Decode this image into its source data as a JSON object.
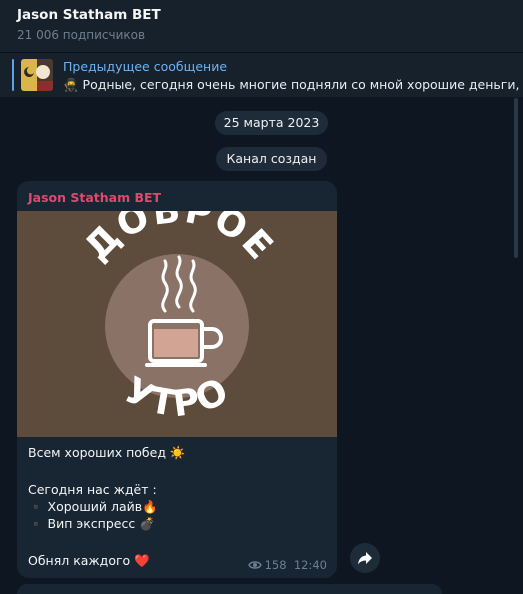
{
  "header": {
    "title": "Jason Statham BET",
    "subtitle": "21 006 подписчиков"
  },
  "pinned": {
    "title": "Предыдущее сообщение",
    "text": "🥷 Родные, сегодня очень многие подняли со мной хорошие деньги, не"
  },
  "service": {
    "date": "25 марта 2023",
    "created": "Канал создан"
  },
  "message": {
    "author": "Jason Statham BET",
    "image_text_top": "ДОБРОЕ",
    "image_text_bottom": "УТРО",
    "lines": [
      "Всем хороших побед ☀️",
      "Сегодня нас ждёт :",
      "▪️ Хороший лайв🔥",
      "▪️ Вип экспресс 💣",
      "Обнял каждого ❤️"
    ],
    "views": "158",
    "time": "12:40"
  },
  "colors": {
    "accent": "#6fb2f2",
    "author": "#e0496f",
    "bubble": "#182533"
  },
  "icons": {
    "views": "eye-icon",
    "share": "share-arrow-icon"
  }
}
